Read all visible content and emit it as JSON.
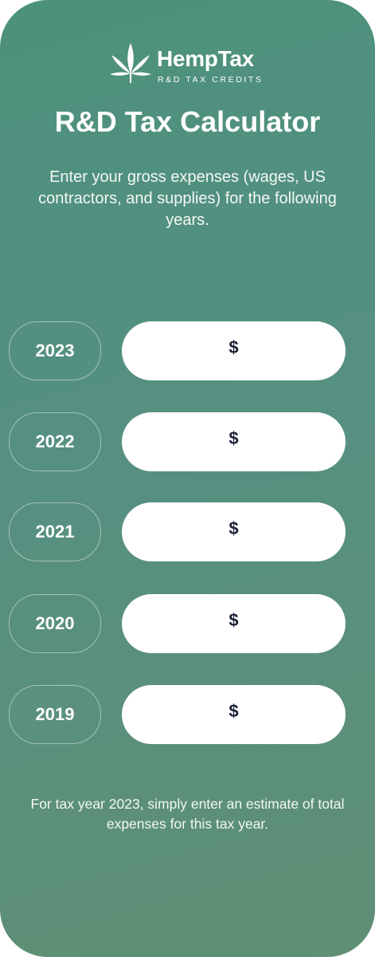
{
  "brand": {
    "name": "HempTax",
    "tagline": "R&D TAX CREDITS",
    "logo_icon": "hemp-leaf-icon"
  },
  "title": "R&D Tax Calculator",
  "description": "Enter your gross expenses (wages, US contractors, and supplies) for the following years.",
  "currency_symbol": "$",
  "rows": [
    {
      "year": "2023",
      "value": ""
    },
    {
      "year": "2022",
      "value": ""
    },
    {
      "year": "2021",
      "value": ""
    },
    {
      "year": "2020",
      "value": ""
    },
    {
      "year": "2019",
      "value": ""
    }
  ],
  "note": "For tax year 2023, simply enter an estimate of total expenses for this tax year.",
  "colors": {
    "background_start": "#4c917c",
    "background_end": "#5f8f75",
    "field": "#ffffff",
    "currency_text": "#1a2238"
  }
}
